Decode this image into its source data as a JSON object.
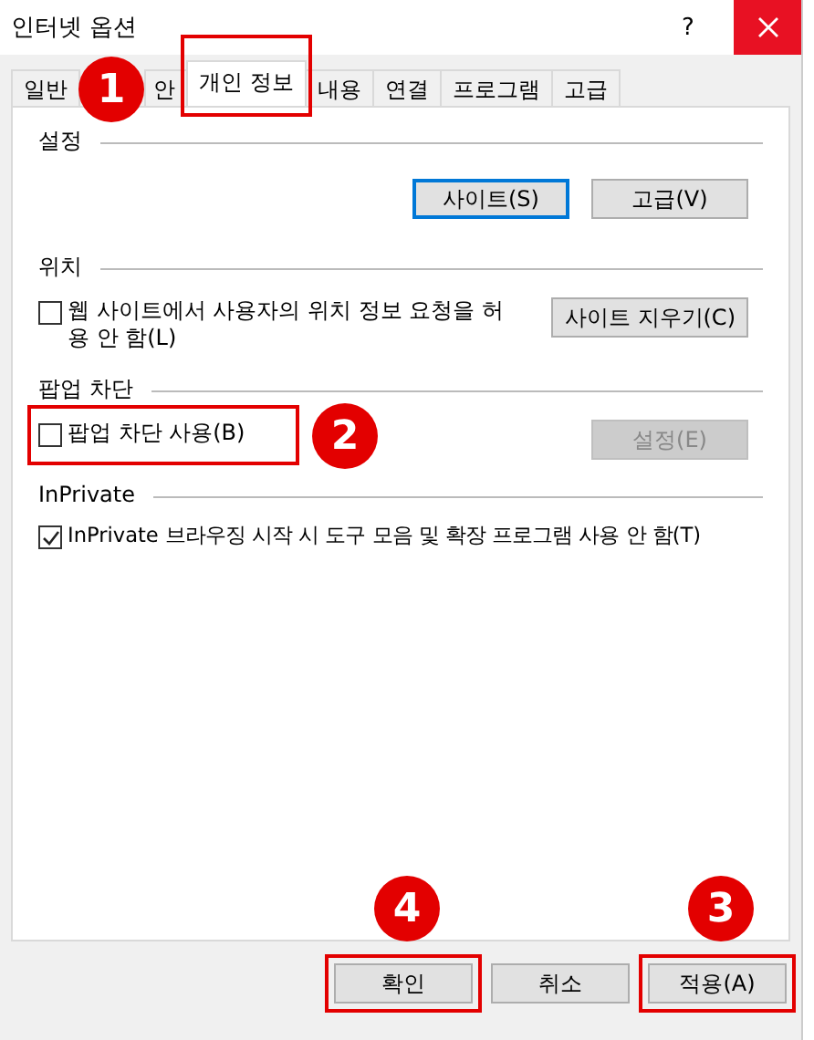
{
  "window": {
    "title": "인터넷 옵션",
    "help": "?"
  },
  "tabs": [
    {
      "label": "일반",
      "selected": false,
      "highlighted": false
    },
    {
      "label": "안",
      "selected": false,
      "highlighted": false,
      "badge": "1"
    },
    {
      "label": "개인 정보",
      "selected": true,
      "highlighted": true
    },
    {
      "label": "내용",
      "selected": false,
      "highlighted": false
    },
    {
      "label": "연결",
      "selected": false,
      "highlighted": false
    },
    {
      "label": "프로그램",
      "selected": false,
      "highlighted": false
    },
    {
      "label": "고급",
      "selected": false,
      "highlighted": false
    }
  ],
  "sections": [
    {
      "title": "설정",
      "rows": [
        {
          "kind": "buttons",
          "buttons": [
            {
              "label": "사이트(S)",
              "focused": true,
              "disabled": false
            },
            {
              "label": "고급(V)",
              "focused": false,
              "disabled": false
            }
          ]
        }
      ]
    },
    {
      "title": "위치",
      "rows": [
        {
          "kind": "checkbox",
          "label": "웹 사이트에서 사용자의 위치 정보 요청을 허용 안 함(L)",
          "checked": false,
          "highlighted": false,
          "button": {
            "label": "사이트 지우기(C)",
            "focused": false,
            "disabled": false
          }
        }
      ]
    },
    {
      "title": "팝업 차단",
      "rows": [
        {
          "kind": "checkbox",
          "label": "팝업 차단 사용(B)",
          "checked": false,
          "highlighted": true,
          "badge": "2",
          "button": {
            "label": "설정(E)",
            "focused": false,
            "disabled": true
          }
        }
      ]
    },
    {
      "title": "InPrivate",
      "rows": [
        {
          "kind": "checkbox",
          "label": "InPrivate 브라우징 시작 시 도구 모음 및 확장 프로그램 사용 안 함(T)",
          "checked": true,
          "highlighted": false
        }
      ]
    }
  ],
  "footer_buttons": [
    {
      "label": "확인",
      "highlighted": true,
      "badge": "4"
    },
    {
      "label": "취소",
      "highlighted": false
    },
    {
      "label": "적용(A)",
      "highlighted": true,
      "badge": "3"
    }
  ]
}
